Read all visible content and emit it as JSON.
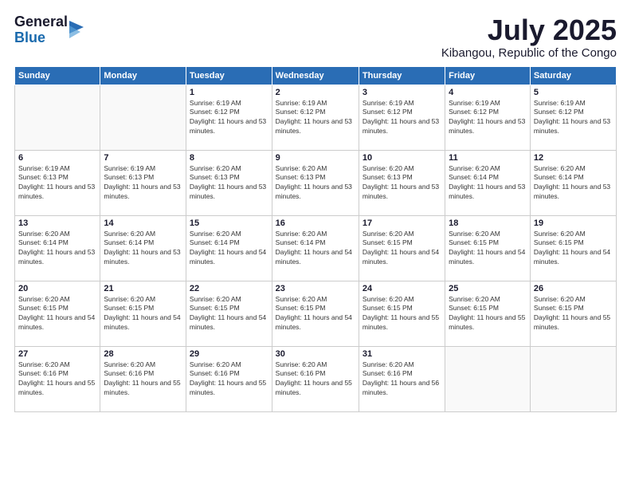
{
  "header": {
    "logo_general": "General",
    "logo_blue": "Blue",
    "month": "July 2025",
    "location": "Kibangou, Republic of the Congo"
  },
  "weekdays": [
    "Sunday",
    "Monday",
    "Tuesday",
    "Wednesday",
    "Thursday",
    "Friday",
    "Saturday"
  ],
  "weeks": [
    [
      {
        "day": "",
        "detail": ""
      },
      {
        "day": "",
        "detail": ""
      },
      {
        "day": "1",
        "detail": "Sunrise: 6:19 AM\nSunset: 6:12 PM\nDaylight: 11 hours and 53 minutes."
      },
      {
        "day": "2",
        "detail": "Sunrise: 6:19 AM\nSunset: 6:12 PM\nDaylight: 11 hours and 53 minutes."
      },
      {
        "day": "3",
        "detail": "Sunrise: 6:19 AM\nSunset: 6:12 PM\nDaylight: 11 hours and 53 minutes."
      },
      {
        "day": "4",
        "detail": "Sunrise: 6:19 AM\nSunset: 6:12 PM\nDaylight: 11 hours and 53 minutes."
      },
      {
        "day": "5",
        "detail": "Sunrise: 6:19 AM\nSunset: 6:12 PM\nDaylight: 11 hours and 53 minutes."
      }
    ],
    [
      {
        "day": "6",
        "detail": "Sunrise: 6:19 AM\nSunset: 6:13 PM\nDaylight: 11 hours and 53 minutes."
      },
      {
        "day": "7",
        "detail": "Sunrise: 6:19 AM\nSunset: 6:13 PM\nDaylight: 11 hours and 53 minutes."
      },
      {
        "day": "8",
        "detail": "Sunrise: 6:20 AM\nSunset: 6:13 PM\nDaylight: 11 hours and 53 minutes."
      },
      {
        "day": "9",
        "detail": "Sunrise: 6:20 AM\nSunset: 6:13 PM\nDaylight: 11 hours and 53 minutes."
      },
      {
        "day": "10",
        "detail": "Sunrise: 6:20 AM\nSunset: 6:13 PM\nDaylight: 11 hours and 53 minutes."
      },
      {
        "day": "11",
        "detail": "Sunrise: 6:20 AM\nSunset: 6:14 PM\nDaylight: 11 hours and 53 minutes."
      },
      {
        "day": "12",
        "detail": "Sunrise: 6:20 AM\nSunset: 6:14 PM\nDaylight: 11 hours and 53 minutes."
      }
    ],
    [
      {
        "day": "13",
        "detail": "Sunrise: 6:20 AM\nSunset: 6:14 PM\nDaylight: 11 hours and 53 minutes."
      },
      {
        "day": "14",
        "detail": "Sunrise: 6:20 AM\nSunset: 6:14 PM\nDaylight: 11 hours and 53 minutes."
      },
      {
        "day": "15",
        "detail": "Sunrise: 6:20 AM\nSunset: 6:14 PM\nDaylight: 11 hours and 54 minutes."
      },
      {
        "day": "16",
        "detail": "Sunrise: 6:20 AM\nSunset: 6:14 PM\nDaylight: 11 hours and 54 minutes."
      },
      {
        "day": "17",
        "detail": "Sunrise: 6:20 AM\nSunset: 6:15 PM\nDaylight: 11 hours and 54 minutes."
      },
      {
        "day": "18",
        "detail": "Sunrise: 6:20 AM\nSunset: 6:15 PM\nDaylight: 11 hours and 54 minutes."
      },
      {
        "day": "19",
        "detail": "Sunrise: 6:20 AM\nSunset: 6:15 PM\nDaylight: 11 hours and 54 minutes."
      }
    ],
    [
      {
        "day": "20",
        "detail": "Sunrise: 6:20 AM\nSunset: 6:15 PM\nDaylight: 11 hours and 54 minutes."
      },
      {
        "day": "21",
        "detail": "Sunrise: 6:20 AM\nSunset: 6:15 PM\nDaylight: 11 hours and 54 minutes."
      },
      {
        "day": "22",
        "detail": "Sunrise: 6:20 AM\nSunset: 6:15 PM\nDaylight: 11 hours and 54 minutes."
      },
      {
        "day": "23",
        "detail": "Sunrise: 6:20 AM\nSunset: 6:15 PM\nDaylight: 11 hours and 54 minutes."
      },
      {
        "day": "24",
        "detail": "Sunrise: 6:20 AM\nSunset: 6:15 PM\nDaylight: 11 hours and 55 minutes."
      },
      {
        "day": "25",
        "detail": "Sunrise: 6:20 AM\nSunset: 6:15 PM\nDaylight: 11 hours and 55 minutes."
      },
      {
        "day": "26",
        "detail": "Sunrise: 6:20 AM\nSunset: 6:15 PM\nDaylight: 11 hours and 55 minutes."
      }
    ],
    [
      {
        "day": "27",
        "detail": "Sunrise: 6:20 AM\nSunset: 6:16 PM\nDaylight: 11 hours and 55 minutes."
      },
      {
        "day": "28",
        "detail": "Sunrise: 6:20 AM\nSunset: 6:16 PM\nDaylight: 11 hours and 55 minutes."
      },
      {
        "day": "29",
        "detail": "Sunrise: 6:20 AM\nSunset: 6:16 PM\nDaylight: 11 hours and 55 minutes."
      },
      {
        "day": "30",
        "detail": "Sunrise: 6:20 AM\nSunset: 6:16 PM\nDaylight: 11 hours and 55 minutes."
      },
      {
        "day": "31",
        "detail": "Sunrise: 6:20 AM\nSunset: 6:16 PM\nDaylight: 11 hours and 56 minutes."
      },
      {
        "day": "",
        "detail": ""
      },
      {
        "day": "",
        "detail": ""
      }
    ]
  ]
}
